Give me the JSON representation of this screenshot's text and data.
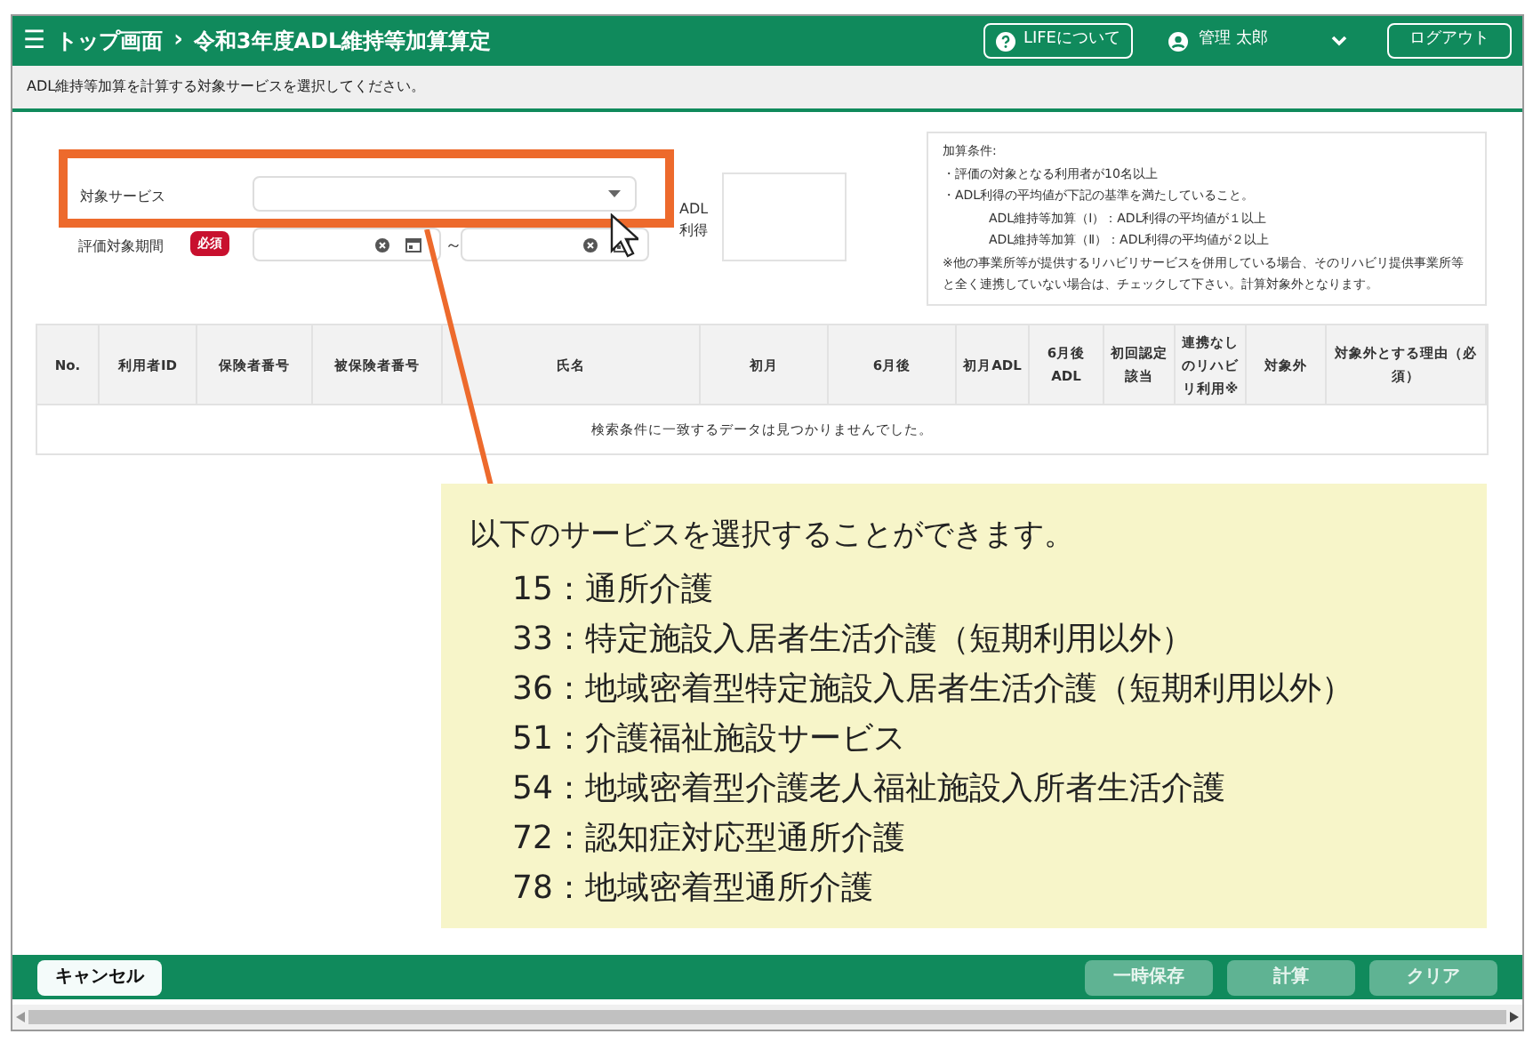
{
  "header": {
    "menu_icon": "☰",
    "breadcrumb": [
      {
        "label": "トップ画面"
      },
      {
        "label": "令和3年度ADL維持等加算算定"
      }
    ],
    "separator": "›",
    "about_button": "LIFEについて",
    "user": "管理 太郎",
    "logout_button": "ログアウト"
  },
  "instruction": "ADL維持等加算を計算する対象サービスを選択してください。",
  "form": {
    "service_label": "対象サービス",
    "period_label": "評価対象期間",
    "required_badge": "必須",
    "range_separator": "～",
    "adl_label": "ADL利得"
  },
  "conditions": {
    "title": "加算条件:",
    "lines": [
      {
        "text": "・評価の対象となる利用者が10名以上",
        "indented": false
      },
      {
        "text": "・ADL利得の平均値が下記の基準を満たしていること。",
        "indented": false
      },
      {
        "text": "ADL維持等加算（Ⅰ）：ADL利得の平均値が１以上",
        "indented": true
      },
      {
        "text": "ADL維持等加算（Ⅱ）：ADL利得の平均値が２以上",
        "indented": true
      },
      {
        "text": "※他の事業所等が提供するリハビリサービスを併用している場合、そのリハビリ提供事業所等と全く連携していない場合は、チェックして下さい。計算対象外となります。",
        "indented": false
      }
    ]
  },
  "table": {
    "columns": [
      {
        "label": "No."
      },
      {
        "label": "利用者ID"
      },
      {
        "label": "保険者番号"
      },
      {
        "label": "被保険者番号"
      },
      {
        "label": "氏名"
      },
      {
        "label": "初月"
      },
      {
        "label": "6月後"
      },
      {
        "label": "初月ADL"
      },
      {
        "label": "6月後ADL"
      },
      {
        "label": "初回認定該当"
      },
      {
        "label": "連携なしのリハビリ利用※"
      },
      {
        "label": "対象外"
      },
      {
        "label": "対象外とする理由（必須）"
      }
    ],
    "empty_message": "検索条件に一致するデータは見つかりませんでした。"
  },
  "callout": {
    "intro": "以下のサービスを選択することができます。",
    "items": [
      {
        "code": "15",
        "name": "通所介護"
      },
      {
        "code": "33",
        "name": "特定施設入居者生活介護（短期利用以外）"
      },
      {
        "code": "36",
        "name": "地域密着型特定施設入居者生活介護（短期利用以外）"
      },
      {
        "code": "51",
        "name": "介護福祉施設サービス"
      },
      {
        "code": "54",
        "name": "地域密着型介護老人福祉施設入所者生活介護"
      },
      {
        "code": "72",
        "name": "認知症対応型通所介護"
      },
      {
        "code": "78",
        "name": "地域密着型通所介護"
      }
    ],
    "separator": "："
  },
  "footer": {
    "buttons": [
      {
        "label": "キャンセル",
        "disabled": false
      },
      {
        "label": "一時保存",
        "disabled": true
      },
      {
        "label": "計算",
        "disabled": true
      },
      {
        "label": "クリア",
        "disabled": true
      }
    ]
  }
}
